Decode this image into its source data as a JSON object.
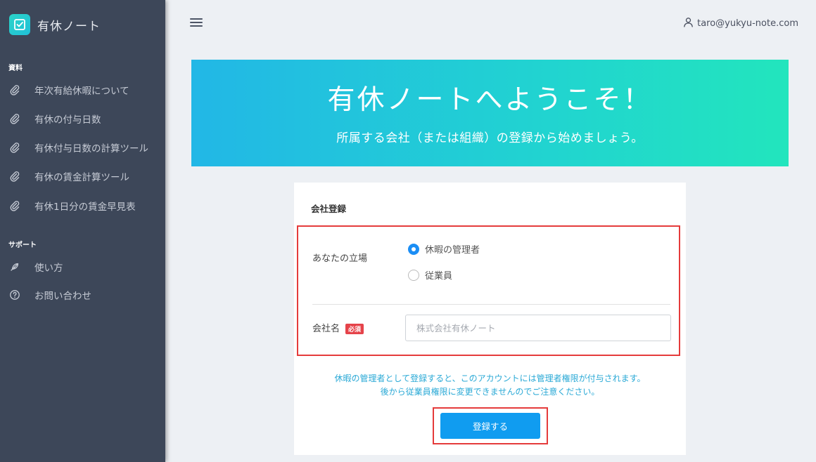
{
  "app": {
    "name": "有休ノート"
  },
  "sidebar": {
    "sections": [
      {
        "label": "資料",
        "items": [
          {
            "label": "年次有給休暇について",
            "icon": "paperclip-icon"
          },
          {
            "label": "有休の付与日数",
            "icon": "paperclip-icon"
          },
          {
            "label": "有休付与日数の計算ツール",
            "icon": "paperclip-icon"
          },
          {
            "label": "有休の賃金計算ツール",
            "icon": "paperclip-icon"
          },
          {
            "label": "有休1日分の賃金早見表",
            "icon": "paperclip-icon"
          }
        ]
      },
      {
        "label": "サポート",
        "items": [
          {
            "label": "使い方",
            "icon": "feather-icon"
          },
          {
            "label": "お問い合わせ",
            "icon": "question-circle-icon"
          }
        ]
      }
    ]
  },
  "header": {
    "user_email": "taro@yukyu-note.com",
    "menu_icon": "hamburger-icon",
    "user_icon": "user-icon"
  },
  "banner": {
    "title": "有休ノートへようこそ！",
    "subtitle": "所属する会社（または組織）の登録から始めましょう。"
  },
  "form": {
    "title": "会社登録",
    "role_label": "あなたの立場",
    "role_options": [
      {
        "label": "休暇の管理者",
        "checked": true
      },
      {
        "label": "従業員",
        "checked": false
      }
    ],
    "company_label": "会社名",
    "required_badge": "必須",
    "company_value": "",
    "company_placeholder": "株式会社有休ノート",
    "notice_line1": "休暇の管理者として登録すると、このアカウントには管理者権限が付与されます。",
    "notice_line2": "後から従業員権限に変更できませんのでご注意ください。",
    "submit_label": "登録する"
  },
  "colors": {
    "sidebar_bg": "#3d4759",
    "banner_start": "#22b7e6",
    "banner_end": "#22e5bd",
    "accent": "#109cf0",
    "highlight": "#e53b3b",
    "notice_text": "#2aa9d6",
    "required_badge": "#e5434a"
  }
}
